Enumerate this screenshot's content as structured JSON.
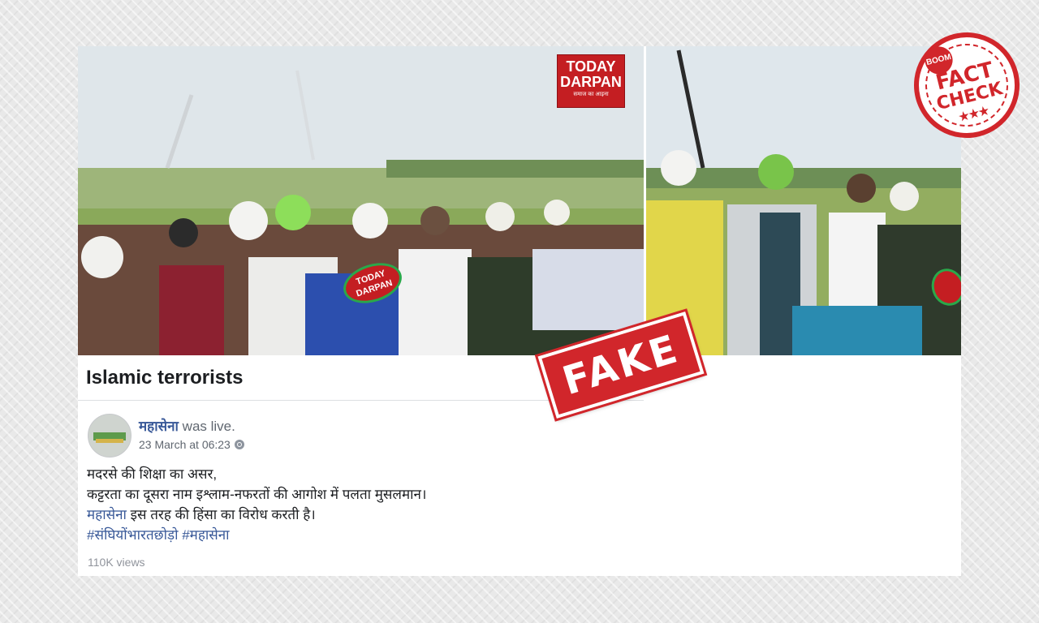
{
  "video": {
    "brand_logo": {
      "line1": "TODAY",
      "line2": "DARPAN",
      "tagline": "समाज का आइना"
    },
    "watermark": "TODAY DARPAN"
  },
  "post": {
    "title": "Islamic terrorists",
    "author_name": "महासेना",
    "author_status": "was live.",
    "timestamp": "23 March at 06:23",
    "privacy_icon": "globe-icon",
    "body": {
      "line1": "मदरसे की शिक्षा का असर,",
      "line2": "कट्टरता का दूसरा नाम इश्लाम-नफरतों की आगोश में पलता मुसलमान।",
      "line3_link": "महासेना",
      "line3_text": " इस तरह की हिंसा का विरोध करती है।",
      "hashtags": "#संघियोंभारतछोड़ो #महासेना"
    },
    "views": "110K views"
  },
  "stamps": {
    "fake": "FAKE",
    "factcheck_brand": "BOOM",
    "factcheck_line1": "FACT",
    "factcheck_line2": "CHECK",
    "factcheck_stars": "★★★"
  },
  "colors": {
    "stamp_red": "#d1262b",
    "link_blue": "#385898",
    "brand_red": "#c41e22"
  }
}
